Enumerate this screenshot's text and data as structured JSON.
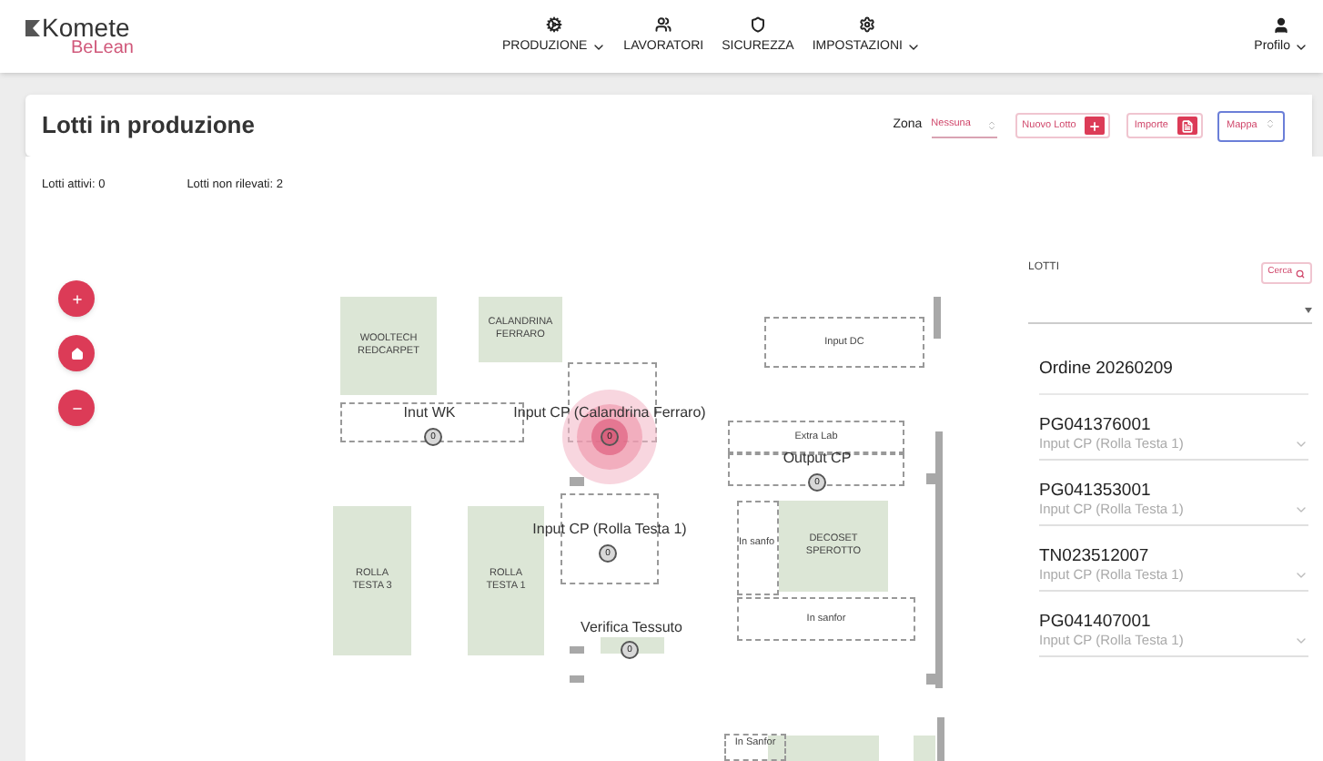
{
  "header": {
    "logo": {
      "brand": "Komete",
      "product": "BeLean"
    },
    "nav": [
      {
        "label": "PRODUZIONE",
        "dropdown": true
      },
      {
        "label": "LAVORATORI",
        "dropdown": false
      },
      {
        "label": "SICUREZZA",
        "dropdown": false
      },
      {
        "label": "IMPOSTAZIONI",
        "dropdown": true
      }
    ],
    "profile": "Profilo"
  },
  "toolbar": {
    "title": "Lotti in produzione",
    "zona_label": "Zona",
    "zona_value": "Nessuna",
    "new_button": "Nuovo Lotto",
    "import_button": "Importe",
    "view_value": "Mappa"
  },
  "stats": [
    "Lotti attivi: 0",
    "Lotti non rilevati: 2"
  ],
  "map": {
    "machines": [
      {
        "label": "WOOLTECH REDCARPET"
      },
      {
        "label": "CALANDRINA FERRARO"
      },
      {
        "label": "ROLLA TESTA 3"
      },
      {
        "label": "ROLLA TESTA 1"
      },
      {
        "label": "DECOSET SPEROTTO"
      }
    ],
    "zones": [
      {
        "kind": "area",
        "label": "Input DC"
      },
      {
        "kind": "station",
        "label": "Inut WK",
        "count": "0",
        "active": false
      },
      {
        "kind": "station",
        "label": "Input CP (Calandrina Ferraro)",
        "count": "0",
        "active": true
      },
      {
        "kind": "area",
        "label": "Extra Lab"
      },
      {
        "kind": "station",
        "label": "Output CP",
        "count": "0",
        "active": false
      },
      {
        "kind": "station",
        "label": "Input CP (Rolla Testa 1)",
        "count": "0",
        "active": false
      },
      {
        "kind": "area",
        "label": "In sanfo"
      },
      {
        "kind": "area",
        "label": "In sanfor"
      },
      {
        "kind": "station",
        "label": "Verifica Tessuto",
        "count": "0",
        "active": false
      },
      {
        "kind": "area",
        "label": "In Sanfor"
      }
    ]
  },
  "lots_panel": {
    "title": "LOTTI",
    "search_button": "Cerca",
    "order": "Ordine 20260209",
    "lots": [
      {
        "code": "PG041376001",
        "location": "Input CP (Rolla Testa 1)",
        "expanded": false
      },
      {
        "code": "PG041353001",
        "location": "Input CP (Rolla Testa 1)",
        "expanded": false
      },
      {
        "code": "TN023512007",
        "location": "Input CP (Rolla Testa 1)",
        "expanded": false
      },
      {
        "code": "PG041407001",
        "location": "Input CP (Rolla Testa 1)",
        "expanded": false
      }
    ]
  }
}
